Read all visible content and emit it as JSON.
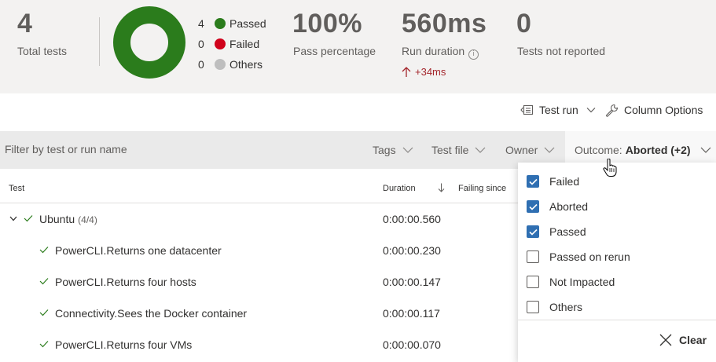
{
  "summary": {
    "total_tests": "4",
    "total_tests_label": "Total tests",
    "legend": [
      {
        "count": "4",
        "label": "Passed",
        "color": "#2b7c1c"
      },
      {
        "count": "0",
        "label": "Failed",
        "color": "#d0021b"
      },
      {
        "count": "0",
        "label": "Others",
        "color": "#bebebe"
      }
    ],
    "pass_percentage": "100%",
    "pass_percentage_label": "Pass percentage",
    "run_duration": "560ms",
    "run_duration_label": "Run duration",
    "run_duration_delta": "+34ms",
    "tests_not_reported": "0",
    "tests_not_reported_label": "Tests not reported",
    "donut_passed_fraction": 1.0
  },
  "toolbar": {
    "test_run_label": "Test run",
    "column_options_label": "Column Options"
  },
  "filters": {
    "search_placeholder": "Filter by test or run name",
    "tags_label": "Tags",
    "test_file_label": "Test file",
    "owner_label": "Owner",
    "outcome_label": "Outcome:",
    "outcome_value": "Aborted (+2)"
  },
  "table": {
    "columns": {
      "test": "Test",
      "duration": "Duration",
      "failing_since": "Failing since"
    },
    "group": {
      "name": "Ubuntu",
      "count": "(4/4)",
      "duration": "0:00:00.560"
    },
    "rows": [
      {
        "name": "PowerCLI.Returns one datacenter",
        "duration": "0:00:00.230"
      },
      {
        "name": "PowerCLI.Returns four hosts",
        "duration": "0:00:00.147"
      },
      {
        "name": "Connectivity.Sees the Docker container",
        "duration": "0:00:00.117"
      },
      {
        "name": "PowerCLI.Returns four VMs",
        "duration": "0:00:00.070"
      }
    ]
  },
  "outcome_menu": {
    "options": [
      {
        "label": "Failed",
        "checked": true
      },
      {
        "label": "Aborted",
        "checked": true
      },
      {
        "label": "Passed",
        "checked": true
      },
      {
        "label": "Passed on rerun",
        "checked": false
      },
      {
        "label": "Not Impacted",
        "checked": false
      },
      {
        "label": "Others",
        "checked": false
      }
    ],
    "clear_label": "Clear"
  },
  "colors": {
    "passed": "#2b7c1c",
    "failed": "#d0021b",
    "others": "#bebebe",
    "checkbox_accent": "#2f6fb2",
    "delta": "#a4262c"
  }
}
